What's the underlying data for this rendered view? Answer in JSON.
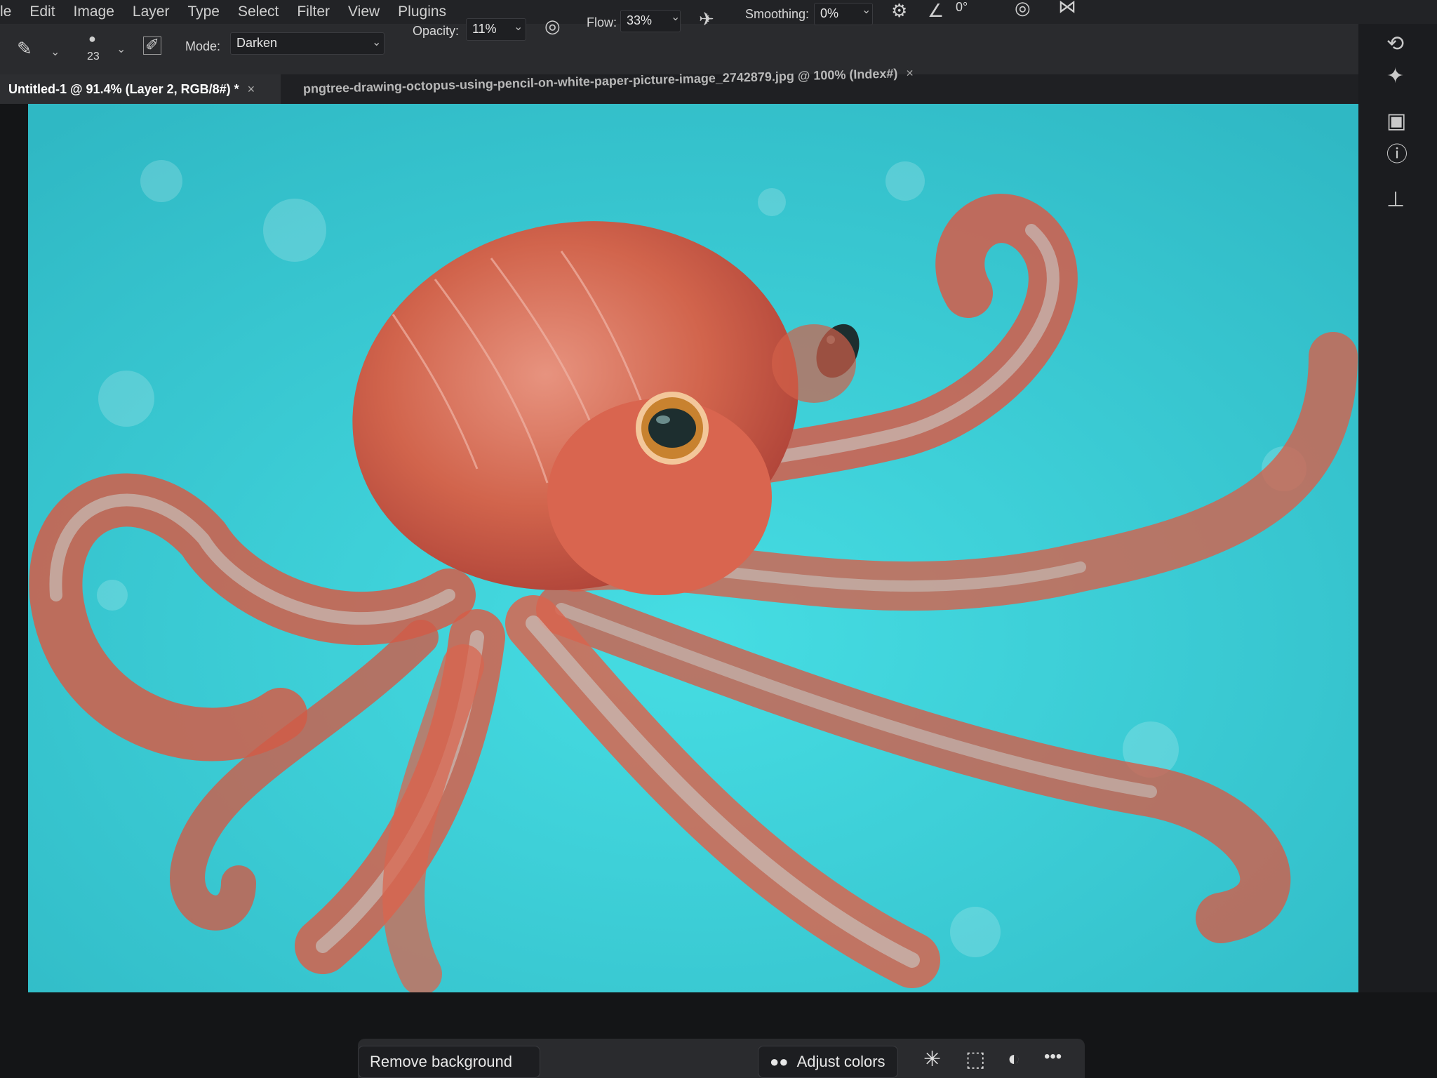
{
  "menu": [
    "le",
    "Edit",
    "Image",
    "Layer",
    "Type",
    "Select",
    "Filter",
    "View",
    "Plugins"
  ],
  "options": {
    "brush_size": "23",
    "mode_label": "Mode:",
    "mode_value": "Darken",
    "opacity_label": "Opacity:",
    "opacity_value": "11%",
    "flow_label": "Flow:",
    "flow_value": "33%",
    "smoothing_label": "Smoothing:",
    "smoothing_value": "0%",
    "angle_value": "0°"
  },
  "tabs": [
    {
      "label": "Untitled-1 @ 91.4% (Layer 2, RGB/8#) *",
      "close": "×"
    },
    {
      "label": "pngtree-drawing-octopus-using-pencil-on-white-paper-picture-image_2742879.jpg @ 100% (Index#)",
      "close": "×"
    }
  ],
  "taskbar": {
    "remove_background": "Remove background",
    "adjust_colors": "Adjust colors",
    "more": "•••"
  },
  "colors": {
    "canvas_bg": "#3fcfd6",
    "octopus": "#d9654f",
    "octopus_light": "#e88f7d",
    "highlight": "#cfe9e8"
  },
  "icons": [
    "brush-icon",
    "brush-tip-icon",
    "brush-settings-icon",
    "pressure-icon",
    "airbrush-icon",
    "settings-gear-icon",
    "angle-icon",
    "symmetry-icon",
    "history-icon",
    "sparkle-icon",
    "library-icon",
    "info-icon",
    "stamp-icon",
    "generative-fill-icon",
    "transform-icon",
    "mask-icon"
  ]
}
